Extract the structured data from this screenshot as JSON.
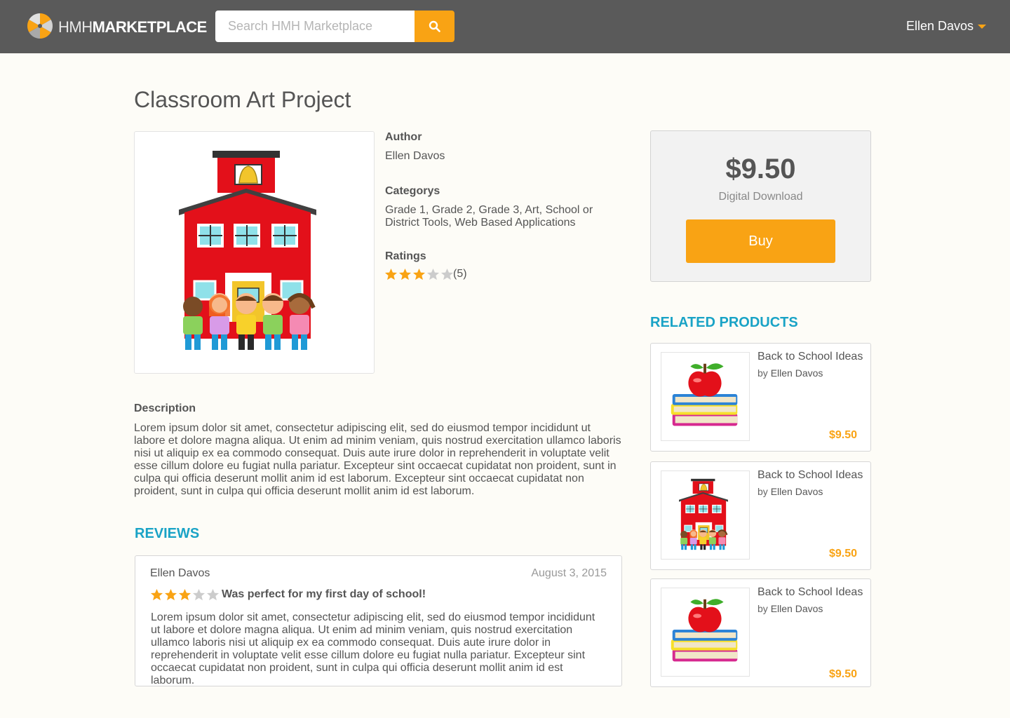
{
  "header": {
    "logo_prefix": "HMH",
    "logo_main": "MARKETPLACE",
    "search_placeholder": "Search HMH Marketplace",
    "user_name": "Ellen Davos",
    "icons": {
      "logo": "hmh-pinwheel-logo",
      "search": "search-icon",
      "menu": "caret-down-icon"
    }
  },
  "product": {
    "title": "Classroom Art Project",
    "author_label": "Author",
    "author": "Ellen Davos",
    "categories_label": "Categorys",
    "categories": "Grade 1, Grade 2, Grade 3, Art, School or District Tools, Web Based Applications",
    "ratings_label": "Ratings",
    "rating": 3,
    "rating_max": 5,
    "rating_count": "(5)",
    "description_label": "Description",
    "description": "Lorem ipsum dolor sit amet, consectetur adipiscing elit, sed do eiusmod tempor incididunt ut labore et dolore magna aliqua. Ut enim ad minim veniam, quis nostrud exercitation ullamco laboris nisi ut aliquip ex ea commodo consequat. Duis aute irure dolor in reprehenderit in voluptate velit esse cillum dolore eu fugiat nulla pariatur. Excepteur sint occaecat cupidatat non proident, sunt in culpa qui officia deserunt mollit anim id est laborum.  Excepteur sint occaecat cupidatat non proident, sunt in culpa qui officia deserunt mollit anim id est laborum."
  },
  "purchase": {
    "price": "$9.50",
    "format": "Digital Download",
    "buy_label": "Buy"
  },
  "reviews": {
    "heading": "REVIEWS",
    "items": [
      {
        "author": "Ellen Davos",
        "date": "August 3, 2015",
        "rating": 3,
        "title": "Was perfect for my first day of school!",
        "body": "Lorem ipsum dolor sit amet, consectetur adipiscing elit, sed do eiusmod tempor incididunt ut labore et dolore magna aliqua. Ut enim ad minim veniam, quis nostrud exercitation ullamco laboris nisi ut aliquip ex ea commodo consequat. Duis aute irure dolor in reprehenderit in voluptate velit esse cillum dolore eu fugiat nulla pariatur. Excepteur sint occaecat cupidatat non proident, sunt in culpa qui officia deserunt mollit anim id est laborum."
      }
    ]
  },
  "related": {
    "heading": "RELATED PRODUCTS",
    "items": [
      {
        "title": "Back to School Ideas",
        "by": "by",
        "author": "Ellen Davos",
        "price": "$9.50",
        "image": "apple-on-books"
      },
      {
        "title": "Back to School Ideas",
        "by": "by",
        "author": "Ellen Davos",
        "price": "$9.50",
        "image": "schoolhouse-with-kids"
      },
      {
        "title": "Back to School Ideas",
        "by": "by",
        "author": "Ellen Davos",
        "price": "$9.50",
        "image": "apple-on-books"
      }
    ]
  },
  "colors": {
    "header_bg": "#5a5a5a",
    "accent_orange": "#f9a314",
    "section_blue": "#19a3c6",
    "star_empty": "#cccccc",
    "page_bg": "#fdfcf7"
  }
}
